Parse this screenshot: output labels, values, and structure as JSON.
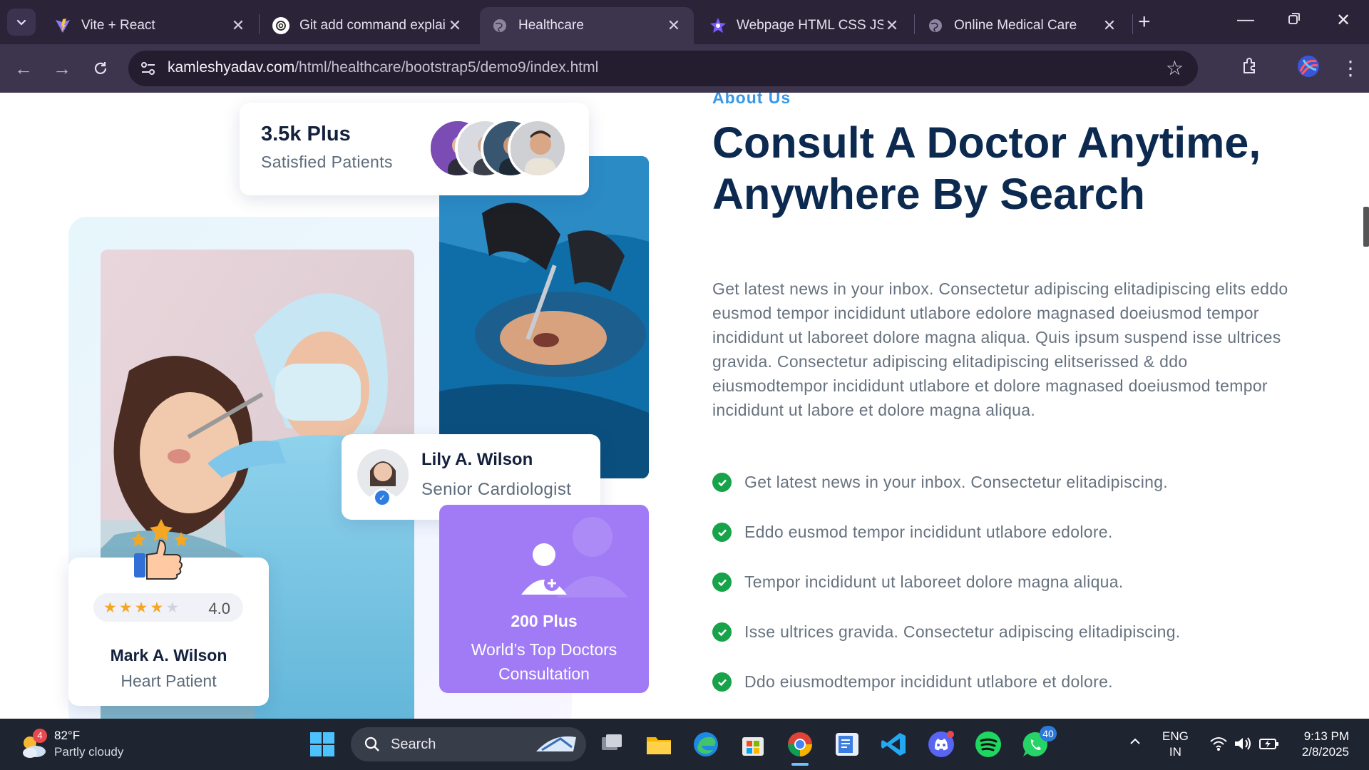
{
  "browser": {
    "tabs": [
      {
        "title": "Vite + React",
        "icon": "vite-icon"
      },
      {
        "title": "Git add command explai",
        "icon": "chatgpt-icon"
      },
      {
        "title": "Healthcare",
        "icon": "globe-icon",
        "active": true
      },
      {
        "title": "Webpage HTML CSS JS E",
        "icon": "star-app-icon"
      },
      {
        "title": "Online Medical Care",
        "icon": "globe-icon"
      }
    ],
    "url_host": "kamleshyadav.com",
    "url_path": "/html/healthcare/bootstrap5/demo9/index.html"
  },
  "page": {
    "stats_card": {
      "value": "3.5k Plus",
      "label": "Satisfied Patients"
    },
    "doctor_card": {
      "name": "Lily A. Wilson",
      "role": "Senior Cardiologist"
    },
    "doctors_card": {
      "value": "200 Plus",
      "label_line1": "World’s Top Doctors",
      "label_line2": "Consultation"
    },
    "patient_card": {
      "rating": 4.0,
      "rating_text": "4.0",
      "name": "Mark A. Wilson",
      "role": "Heart Patient"
    },
    "about": {
      "label": "About Us",
      "title_line1": "Consult A Doctor Anytime,",
      "title_line2": "Anywhere By Search",
      "body": "Get latest news in your inbox. Consectetur adipiscing elitadipiscing elits eddo eusmod tempor incididunt utlabore edolore magnased doeiusmod tempor incididunt ut laboreet dolore magna aliqua. Quis ipsum suspend isse ultrices gravida. Consectetur adipiscing elitadipiscing elitserissed & ddo eiusmodtempor incididunt utlabore et dolore magnased doeiusmod tempor incididunt ut labore et dolore magna aliqua.",
      "checklist": [
        "Get latest news in your inbox. Consectetur elitadipiscing.",
        "Eddo eusmod tempor incididunt utlabore edolore.",
        "Tempor incididunt ut laboreet dolore magna aliqua.",
        "Isse ultrices gravida. Consectetur adipiscing elitadipiscing.",
        "Ddo eiusmodtempor incididunt utlabore et dolore."
      ]
    }
  },
  "taskbar": {
    "weather_temp": "82°F",
    "weather_cond": "Partly cloudy",
    "weather_badge": "4",
    "search_label": "Search",
    "whatsapp_badge": "40",
    "lang_line1": "ENG",
    "lang_line2": "IN",
    "time": "9:13 PM",
    "date": "2/8/2025"
  },
  "colors": {
    "accent_blue": "#3797e8",
    "heading_navy": "#0c2a4f",
    "check_green": "#16a34a",
    "purple_card": "#a17bf6",
    "star_gold": "#f5a623"
  }
}
